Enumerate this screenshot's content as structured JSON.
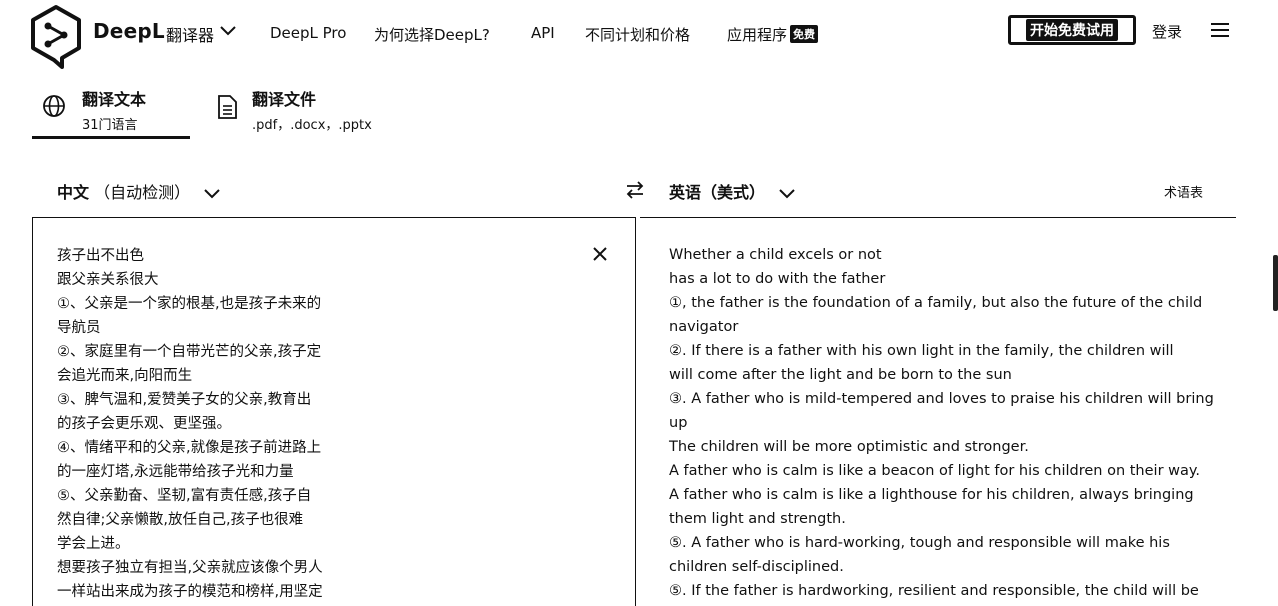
{
  "header": {
    "brand": "DeepL",
    "brand_sub": "翻译器",
    "nav": [
      {
        "label": "DeepL Pro"
      },
      {
        "label": "为何选择DeepL?"
      },
      {
        "label": "API"
      },
      {
        "label": "不同计划和价格"
      },
      {
        "label": "应用程序"
      }
    ],
    "free_badge": "免费",
    "trial_button": "开始免费试用",
    "login": "登录"
  },
  "tabs": [
    {
      "title": "翻译文本",
      "subtitle": "31门语言",
      "icon": "globe-icon"
    },
    {
      "title": "翻译文件",
      "subtitle": ".pdf，.docx，.pptx",
      "icon": "document-icon"
    }
  ],
  "languages": {
    "source_lang": "中文",
    "source_note": "（自动检测）",
    "target_lang": "英语（美式）",
    "glossary": "术语表"
  },
  "source": {
    "lines": [
      "孩子出不出色",
      "跟父亲关系很大",
      "①、父亲是一个家的根基,也是孩子未来的",
      "导航员",
      "②、家庭里有一个自带光芒的父亲,孩子定",
      "会追光而来,向阳而生",
      "③、脾气温和,爱赞美子女的父亲,教育出",
      "的孩子会更乐观、更坚强。",
      "④、情绪平和的父亲,就像是孩子前进路上",
      "的一座灯塔,永远能带给孩子光和力量",
      "⑤、父亲勤奋、坚韧,富有责任感,孩子自",
      "然自律;父亲懒散,放任自己,孩子也很难",
      "学会上进。",
      "想要孩子独立有担当,父亲就应该像个男人",
      "一样站出来成为孩子的模范和榜样,用坚定"
    ]
  },
  "target": {
    "lines": [
      "Whether a child excels or not",
      "has a lot to do with the father",
      "①, the father is the foundation of a family, but also the future of the child",
      "navigator",
      "②. If there is a father with his own light in the family, the children will",
      "will come after the light and be born to the sun",
      "③. A father who is mild-tempered and loves to praise his children will bring",
      "up",
      "The children will be more optimistic and stronger.",
      "A father who is calm is like a beacon of light for his children on their way.",
      "A father who is calm is like a lighthouse for his children, always bringing",
      "them light and strength.",
      "⑤. A father who is hard-working, tough and responsible will make his",
      "children self-disciplined.",
      "⑤. If the father is hardworking, resilient and responsible, the child will be"
    ]
  },
  "icons": {
    "logo": "deepl-logo-icon",
    "chevron": "chevron-down-icon",
    "swap": "swap-icon",
    "clear": "close-icon",
    "menu": "hamburger-menu-icon"
  }
}
